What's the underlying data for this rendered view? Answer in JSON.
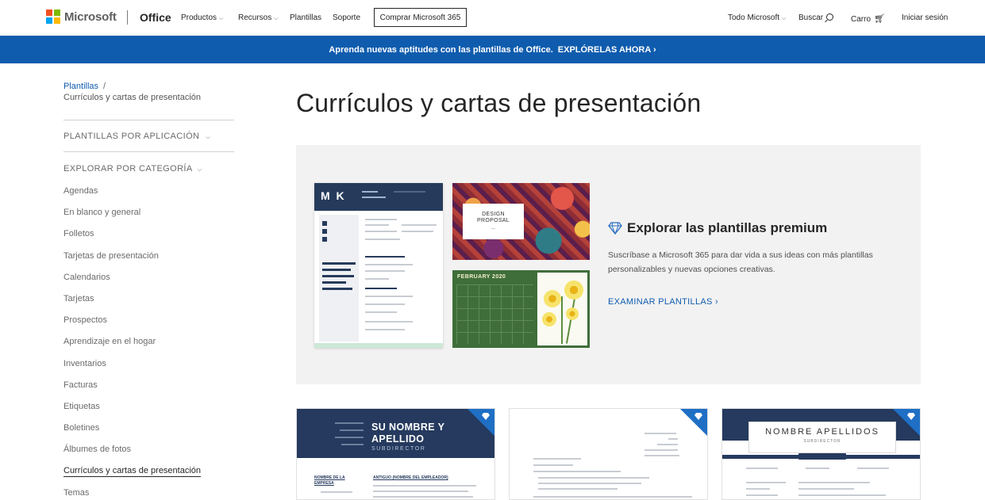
{
  "topnav": {
    "brand": "Microsoft",
    "product": "Office",
    "links": [
      {
        "label": "Productos",
        "has_menu": true
      },
      {
        "label": "Recursos",
        "has_menu": true
      },
      {
        "label": "Plantillas",
        "has_menu": false
      },
      {
        "label": "Soporte",
        "has_menu": false
      }
    ],
    "buy_label": "Comprar Microsoft 365",
    "all_microsoft": "Todo Microsoft",
    "search_label": "Buscar",
    "cart_label": "Carro",
    "signin_label": "Iniciar sesión"
  },
  "banner": {
    "text": "Aprenda nuevas aptitudes con las plantillas de Office.",
    "cta": "EXPLÓRELAS AHORA",
    "cta_icon": "chevron-right-icon"
  },
  "sidebar": {
    "breadcrumb_root": "Plantillas",
    "breadcrumb_sep": "/",
    "breadcrumb_current": "Currículos y cartas de presentación",
    "by_app_heading": "PLANTILLAS POR APLICACIÓN",
    "by_category_heading": "EXPLORAR POR CATEGORÍA",
    "categories": [
      "Agendas",
      "En blanco y general",
      "Folletos",
      "Tarjetas de presentación",
      "Calendarios",
      "Tarjetas",
      "Prospectos",
      "Aprendizaje en el hogar",
      "Inventarios",
      "Facturas",
      "Etiquetas",
      "Boletines",
      "Álbumes de fotos",
      "Currículos y cartas de presentación",
      "Temas"
    ],
    "active_category": "Currículos y cartas de presentación"
  },
  "main": {
    "title": "Currículos y cartas de presentación",
    "premium": {
      "heading": "Explorar las plantillas premium",
      "icon": "diamond-icon",
      "description": "Suscríbase a Microsoft 365 para dar vida a sus ideas con más plantillas personalizables y nuevas opciones creativas.",
      "link": "EXAMINAR PLANTILLAS",
      "thumbs": {
        "resume_initials": "M K",
        "proposal_title": "DESIGN\nPROPOSAL",
        "calendar_title": "FEBRUARY 2020"
      }
    },
    "templates": [
      {
        "name": "SU NOMBRE Y APELLIDO",
        "subtitle": "SUBDIRECTOR",
        "section": "NOMBRE DE LA EMPRESA",
        "section2": "ANTIGUO (NOMBRE DEL EMPLEADOR)",
        "premium": true
      },
      {
        "name": "",
        "premium": true
      },
      {
        "name": "NOMBRE APELLIDOS",
        "subtitle": "SUBDIRECTOR",
        "premium": true
      }
    ]
  },
  "colors": {
    "banner": "#0f5cae",
    "link": "#0f5cae",
    "panel": "#f2f2f2",
    "navy": "#253a5e",
    "premium_badge": "#1f6fc5"
  }
}
